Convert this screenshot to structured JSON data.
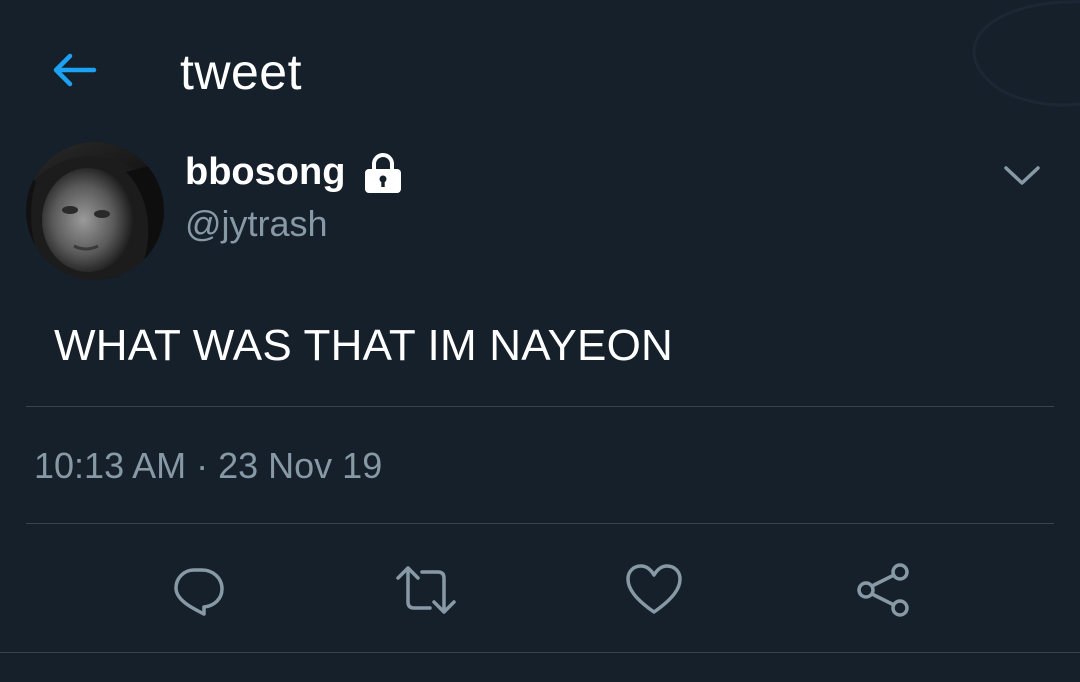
{
  "header": {
    "title": "tweet",
    "back_icon": "back-arrow-icon"
  },
  "user": {
    "display_name": "bbosong",
    "handle": "@jytrash",
    "protected_icon": "lock-icon"
  },
  "tweet": {
    "text": "WHAT WAS THAT IM NAYEON",
    "time": "10:13 AM",
    "separator": "·",
    "date": "23 Nov 19"
  },
  "actions": [
    {
      "name": "reply",
      "icon": "reply-icon"
    },
    {
      "name": "retweet",
      "icon": "retweet-icon"
    },
    {
      "name": "like",
      "icon": "heart-icon"
    },
    {
      "name": "share",
      "icon": "share-icon"
    }
  ],
  "colors": {
    "background": "#15202b",
    "accent": "#1da1f2",
    "secondary_text": "#8899a6",
    "divider": "#38444d",
    "action_icon": "#8899a6"
  }
}
